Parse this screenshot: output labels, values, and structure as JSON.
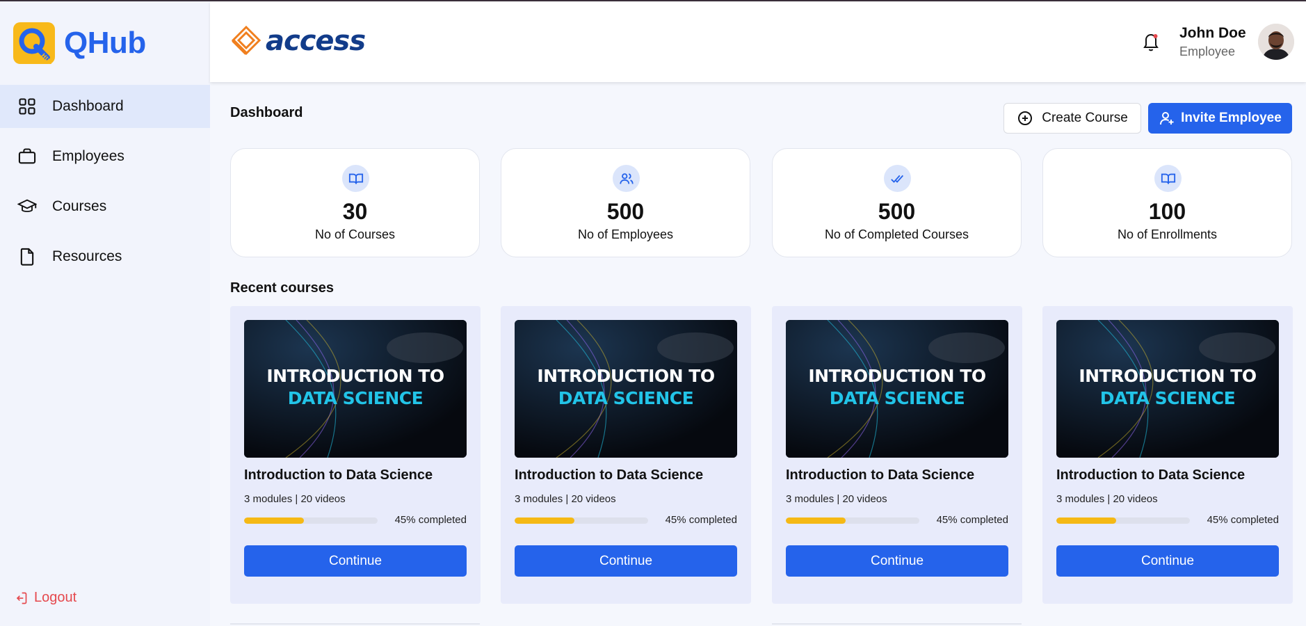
{
  "app": {
    "name": "QHub",
    "logo_letter": "Q",
    "logo_sub": "HUB"
  },
  "sidebar": {
    "items": [
      {
        "label": "Dashboard",
        "icon": "dashboard-grid-icon",
        "active": true
      },
      {
        "label": "Employees",
        "icon": "briefcase-icon",
        "active": false
      },
      {
        "label": "Courses",
        "icon": "graduation-cap-icon",
        "active": false
      },
      {
        "label": "Resources",
        "icon": "file-icon",
        "active": false
      }
    ],
    "logout_label": "Logout"
  },
  "header": {
    "company": "access",
    "user": {
      "name": "John Doe",
      "role": "Employee"
    }
  },
  "dashboard": {
    "title": "Dashboard",
    "create_label": "Create Course",
    "invite_label": "Invite Employee",
    "stats": [
      {
        "value": "30",
        "label": "No of Courses",
        "icon": "book-open-icon"
      },
      {
        "value": "500",
        "label": "No of Employees",
        "icon": "users-icon"
      },
      {
        "value": "500",
        "label": "No of Completed Courses",
        "icon": "double-check-icon"
      },
      {
        "value": "100",
        "label": "No of Enrollments",
        "icon": "book-open-icon"
      }
    ],
    "recent_title": "Recent courses",
    "courses": [
      {
        "thumb_line1": "INTRODUCTION TO",
        "thumb_line2": "DATA SCIENCE",
        "title": "Introduction to Data Science",
        "meta": "3 modules | 20 videos",
        "progress": 0.45,
        "progress_text": "45% completed",
        "button": "Continue"
      },
      {
        "thumb_line1": "INTRODUCTION TO",
        "thumb_line2": "DATA SCIENCE",
        "title": "Introduction to Data Science",
        "meta": "3 modules | 20 videos",
        "progress": 0.45,
        "progress_text": "45% completed",
        "button": "Continue"
      },
      {
        "thumb_line1": "INTRODUCTION TO",
        "thumb_line2": "DATA SCIENCE",
        "title": "Introduction to Data Science",
        "meta": "3 modules | 20 videos",
        "progress": 0.45,
        "progress_text": "45% completed",
        "button": "Continue"
      },
      {
        "thumb_line1": "INTRODUCTION TO",
        "thumb_line2": "DATA SCIENCE",
        "title": "Introduction to Data Science",
        "meta": "3 modules | 20 videos",
        "progress": 0.45,
        "progress_text": "45% completed",
        "button": "Continue"
      }
    ]
  },
  "colors": {
    "primary": "#2563eb",
    "accent_yellow": "#f5b915",
    "logout_red": "#e5484d",
    "sidebar_bg": "#f2f4fc",
    "card_bg": "#e8ebfb"
  }
}
